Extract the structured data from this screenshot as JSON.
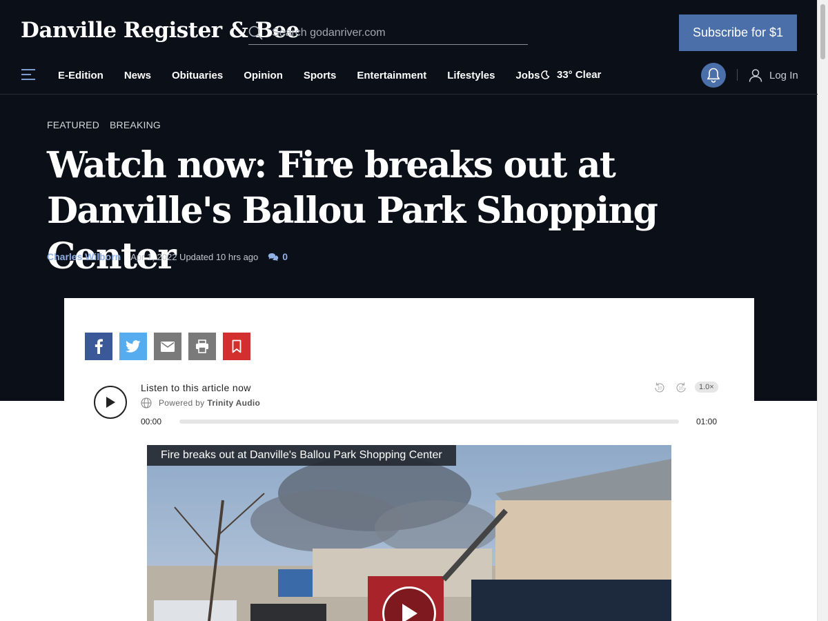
{
  "header": {
    "logo_text": "Danville Register & Bee",
    "search_placeholder": "Search godanriver.com",
    "subscribe_label": "Subscribe for $1"
  },
  "nav": {
    "items": [
      "E-Edition",
      "News",
      "Obituaries",
      "Opinion",
      "Sports",
      "Entertainment",
      "Lifestyles",
      "Jobs"
    ],
    "weather": "33° Clear",
    "login_label": "Log In"
  },
  "article": {
    "tags": [
      "FEATURED",
      "BREAKING"
    ],
    "headline": "Watch now: Fire breaks out at Danville's Ballou Park Shopping Center",
    "author": "Charles Wilborn",
    "date": "Apr 1, 2022 Updated 10 hrs ago",
    "comment_count": "0"
  },
  "share_icons": [
    "facebook-icon",
    "twitter-icon",
    "email-icon",
    "print-icon",
    "bookmark-icon"
  ],
  "audio_player": {
    "listen_label": "Listen to this article now",
    "powered_prefix": "Powered by",
    "powered_brand": "Trinity Audio",
    "time_start": "00:00",
    "time_end": "01:00",
    "rewind_label": "10",
    "forward_label": "10",
    "speed": "1.0×",
    "progress": 0
  },
  "video": {
    "title": "Fire breaks out at Danville's Ballou Park Shopping Center"
  },
  "colors": {
    "header_bg": "#0b0f18",
    "accent": "#4b6fa8",
    "link": "#8fb0e4",
    "facebook": "#3b5998",
    "twitter": "#55acee",
    "bookmark": "#d32f2f"
  }
}
